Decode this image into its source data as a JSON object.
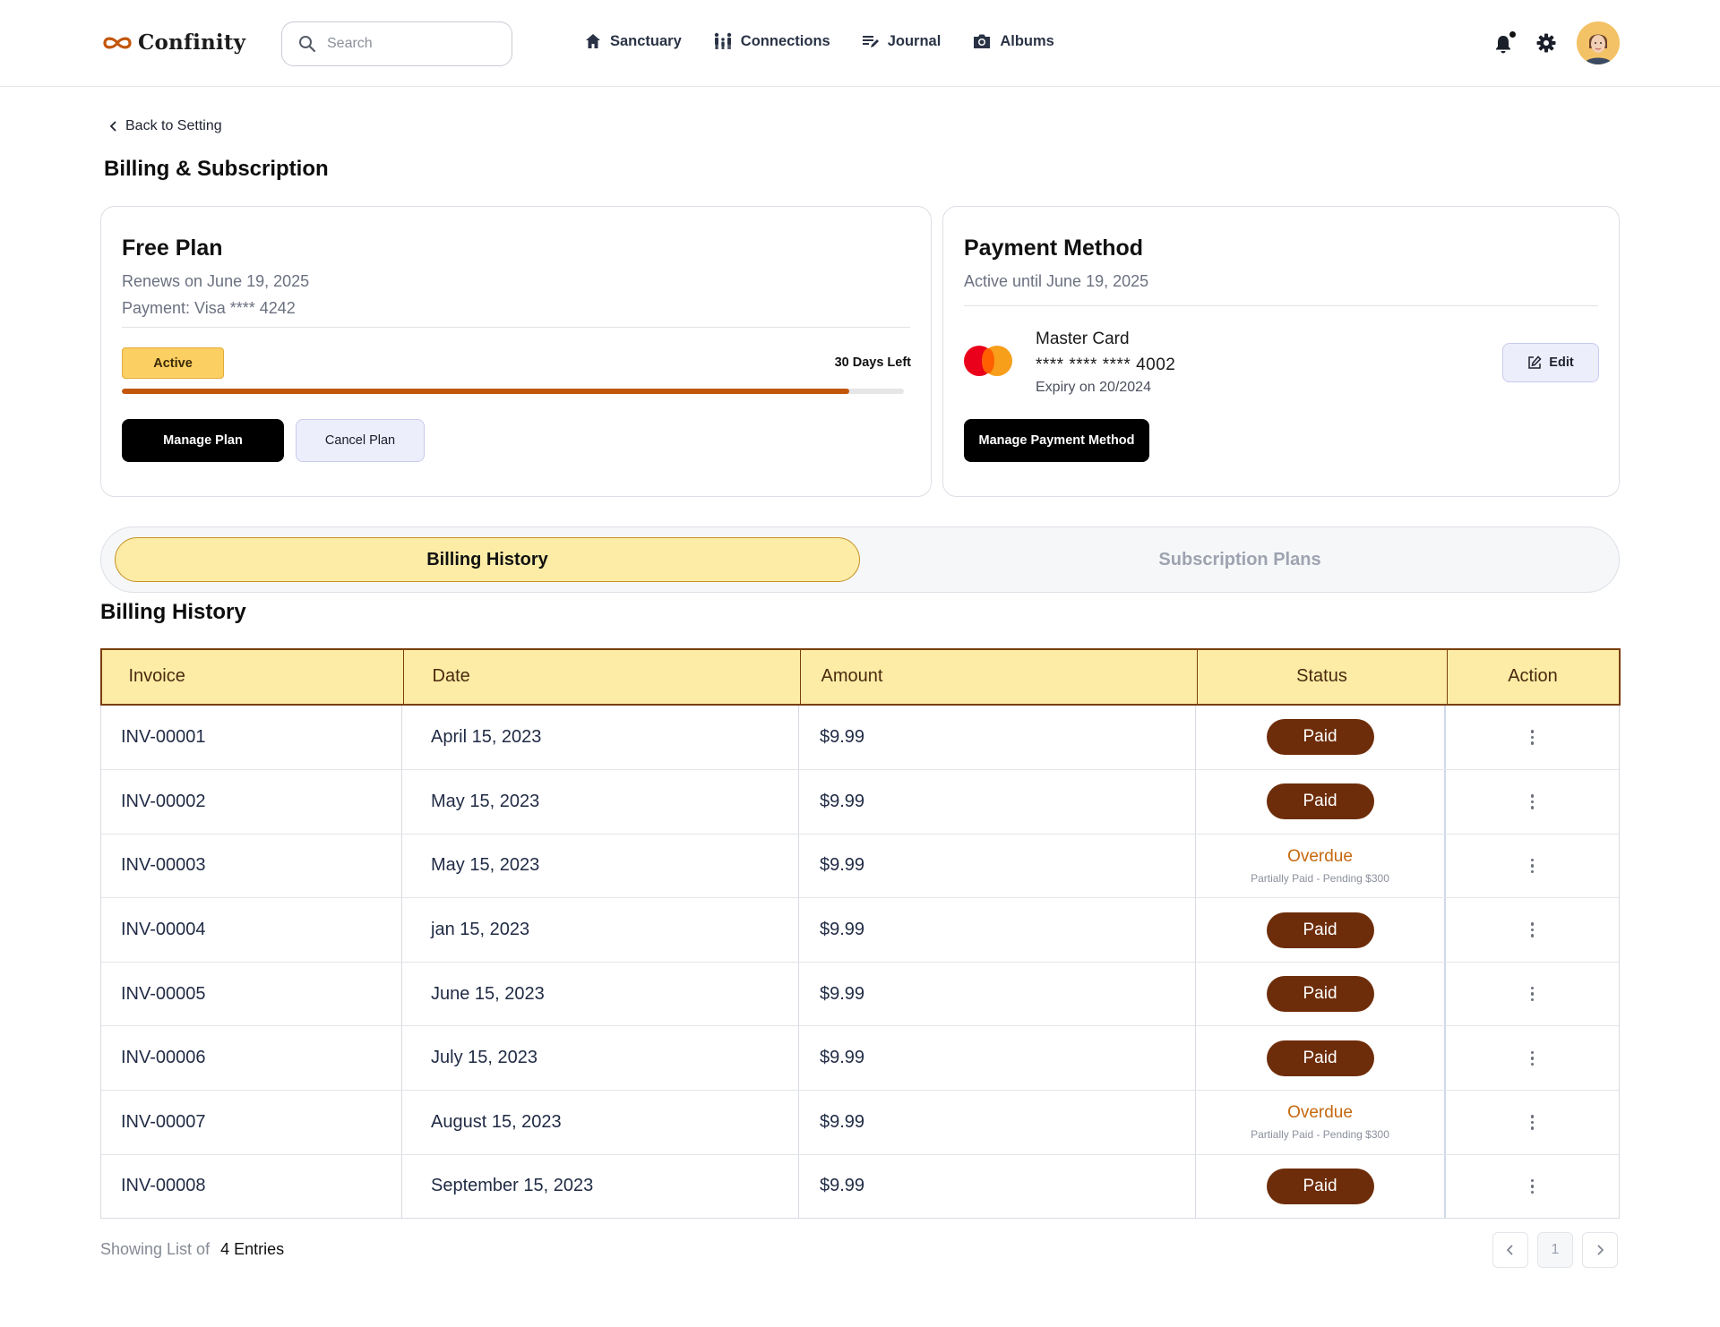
{
  "app": {
    "logo_text": "Confinity"
  },
  "search": {
    "placeholder": "Search"
  },
  "nav": [
    {
      "label": "Sanctuary",
      "icon": "home-icon"
    },
    {
      "label": "Connections",
      "icon": "people-icon"
    },
    {
      "label": "Journal",
      "icon": "journal-icon"
    },
    {
      "label": "Albums",
      "icon": "camera-icon"
    }
  ],
  "page": {
    "back_label": "Back to Setting",
    "title": "Billing & Subscription"
  },
  "plan_card": {
    "title": "Free Plan",
    "renews": "Renews on June 19, 2025",
    "payment": "Payment: Visa **** 4242",
    "status_badge": "Active",
    "days_left": "30 Days Left",
    "progress_percent": 93,
    "manage_label": "Manage Plan",
    "cancel_label": "Cancel Plan"
  },
  "payment_card": {
    "title": "Payment Method",
    "active_until": "Active until June 19, 2025",
    "card_name": "Master Card",
    "card_number": "**** **** **** 4002",
    "expiry": "Expiry on 20/2024",
    "edit_label": "Edit",
    "manage_label": "Manage Payment Method"
  },
  "tabs": [
    {
      "label": "Billing History",
      "active": true
    },
    {
      "label": "Subscription Plans",
      "active": false
    }
  ],
  "billing": {
    "section_title": "Billing History",
    "columns": [
      "Invoice",
      "Date",
      "Amount",
      "Status",
      "Action"
    ],
    "rows": [
      {
        "invoice": "INV-00001",
        "date": "April 15, 2023",
        "amount": "$9.99",
        "status": "Paid",
        "note": ""
      },
      {
        "invoice": "INV-00002",
        "date": "May  15, 2023",
        "amount": "$9.99",
        "status": "Paid",
        "note": ""
      },
      {
        "invoice": "INV-00003",
        "date": "May 15, 2023",
        "amount": "$9.99",
        "status": "Overdue",
        "note": "Partially Paid - Pending $300"
      },
      {
        "invoice": "INV-00004",
        "date": "jan 15, 2023",
        "amount": "$9.99",
        "status": "Paid",
        "note": ""
      },
      {
        "invoice": "INV-00005",
        "date": "June 15, 2023",
        "amount": "$9.99",
        "status": "Paid",
        "note": ""
      },
      {
        "invoice": "INV-00006",
        "date": "July 15, 2023",
        "amount": "$9.99",
        "status": "Paid",
        "note": ""
      },
      {
        "invoice": "INV-00007",
        "date": "August 15, 2023",
        "amount": "$9.99",
        "status": "Overdue",
        "note": "Partially Paid - Pending $300"
      },
      {
        "invoice": "INV-00008",
        "date": "September 15, 2023",
        "amount": "$9.99",
        "status": "Paid",
        "note": ""
      }
    ]
  },
  "footer": {
    "showing_label": "Showing List of",
    "entries_label": "4 Entries",
    "current_page": "1"
  },
  "colors": {
    "accent_yellow": "#fdeca6",
    "paid_pill": "#6e2d0a",
    "overdue_text": "#c5680f",
    "progress_fill": "#c2570c"
  }
}
